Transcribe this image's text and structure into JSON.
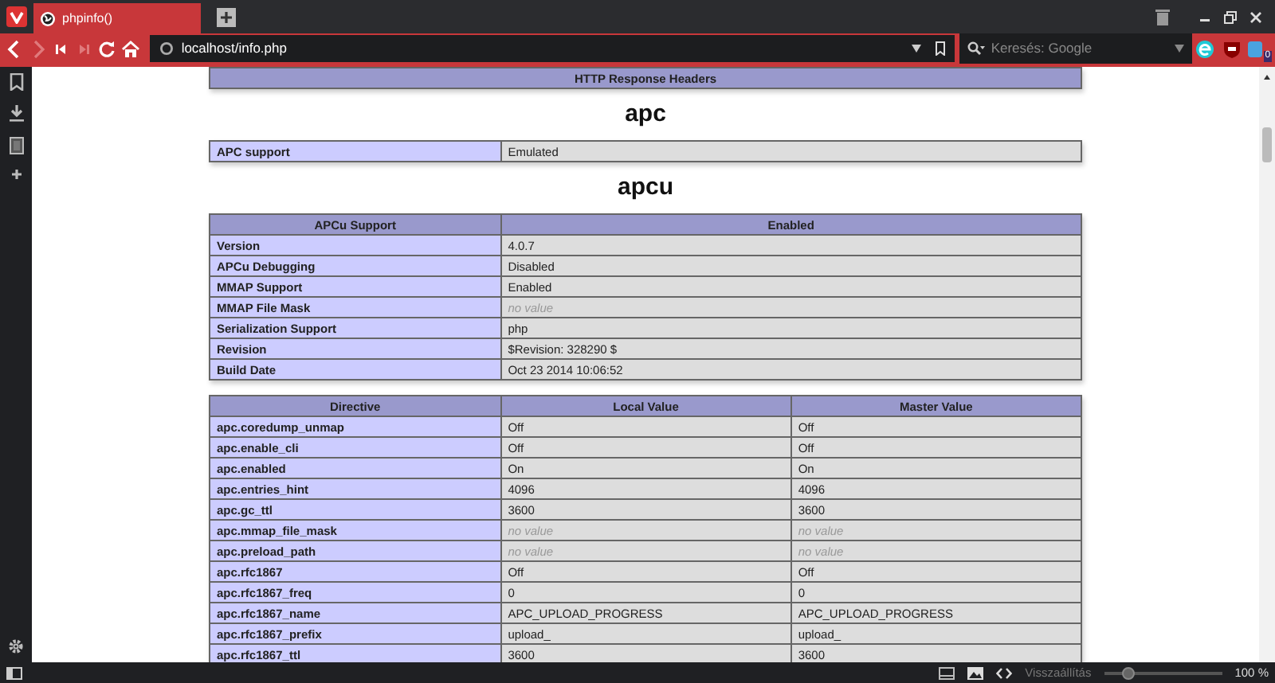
{
  "browser": {
    "tabs": [
      {
        "title": "phpinfo()",
        "selected": true
      }
    ],
    "address_bar": {
      "value": "localhost/info.php"
    },
    "search_field": {
      "placeholder": "Keresés: Google"
    },
    "extension_badge": "0"
  },
  "page": {
    "blocks": [
      {
        "kind": "table",
        "header": [
          "HTTP Response Headers"
        ]
      },
      {
        "kind": "heading",
        "text": "apc"
      },
      {
        "kind": "table",
        "rows": [
          {
            "name": "APC support",
            "values": [
              "Emulated"
            ],
            "no_value": false
          }
        ]
      },
      {
        "kind": "heading",
        "text": "apcu"
      },
      {
        "kind": "table",
        "header": [
          "APCu Support",
          "Enabled"
        ],
        "rows": [
          {
            "name": "Version",
            "values": [
              "4.0.7"
            ],
            "no_value": false
          },
          {
            "name": "APCu Debugging",
            "values": [
              "Disabled"
            ],
            "no_value": false
          },
          {
            "name": "MMAP Support",
            "values": [
              "Enabled"
            ],
            "no_value": false
          },
          {
            "name": "MMAP File Mask",
            "values": [
              "no value"
            ],
            "no_value": true
          },
          {
            "name": "Serialization Support",
            "values": [
              "php"
            ],
            "no_value": false
          },
          {
            "name": "Revision",
            "values": [
              "$Revision: 328290 $"
            ],
            "no_value": false
          },
          {
            "name": "Build Date",
            "values": [
              "Oct 23 2014 10:06:52"
            ],
            "no_value": false
          }
        ]
      },
      {
        "kind": "table",
        "header": [
          "Directive",
          "Local Value",
          "Master Value"
        ],
        "rows": [
          {
            "name": "apc.coredump_unmap",
            "values": [
              "Off",
              "Off"
            ],
            "no_value": false
          },
          {
            "name": "apc.enable_cli",
            "values": [
              "Off",
              "Off"
            ],
            "no_value": false
          },
          {
            "name": "apc.enabled",
            "values": [
              "On",
              "On"
            ],
            "no_value": false
          },
          {
            "name": "apc.entries_hint",
            "values": [
              "4096",
              "4096"
            ],
            "no_value": false
          },
          {
            "name": "apc.gc_ttl",
            "values": [
              "3600",
              "3600"
            ],
            "no_value": false
          },
          {
            "name": "apc.mmap_file_mask",
            "values": [
              "no value",
              "no value"
            ],
            "no_value": true
          },
          {
            "name": "apc.preload_path",
            "values": [
              "no value",
              "no value"
            ],
            "no_value": true
          },
          {
            "name": "apc.rfc1867",
            "values": [
              "Off",
              "Off"
            ],
            "no_value": false
          },
          {
            "name": "apc.rfc1867_freq",
            "values": [
              "0",
              "0"
            ],
            "no_value": false
          },
          {
            "name": "apc.rfc1867_name",
            "values": [
              "APC_UPLOAD_PROGRESS",
              "APC_UPLOAD_PROGRESS"
            ],
            "no_value": false
          },
          {
            "name": "apc.rfc1867_prefix",
            "values": [
              "upload_",
              "upload_"
            ],
            "no_value": false
          },
          {
            "name": "apc.rfc1867_ttl",
            "values": [
              "3600",
              "3600"
            ],
            "no_value": false
          }
        ]
      }
    ]
  },
  "status_bar": {
    "reset_label": "Visszaállítás",
    "zoom": {
      "level": 0.2,
      "reading": "100 %"
    }
  }
}
